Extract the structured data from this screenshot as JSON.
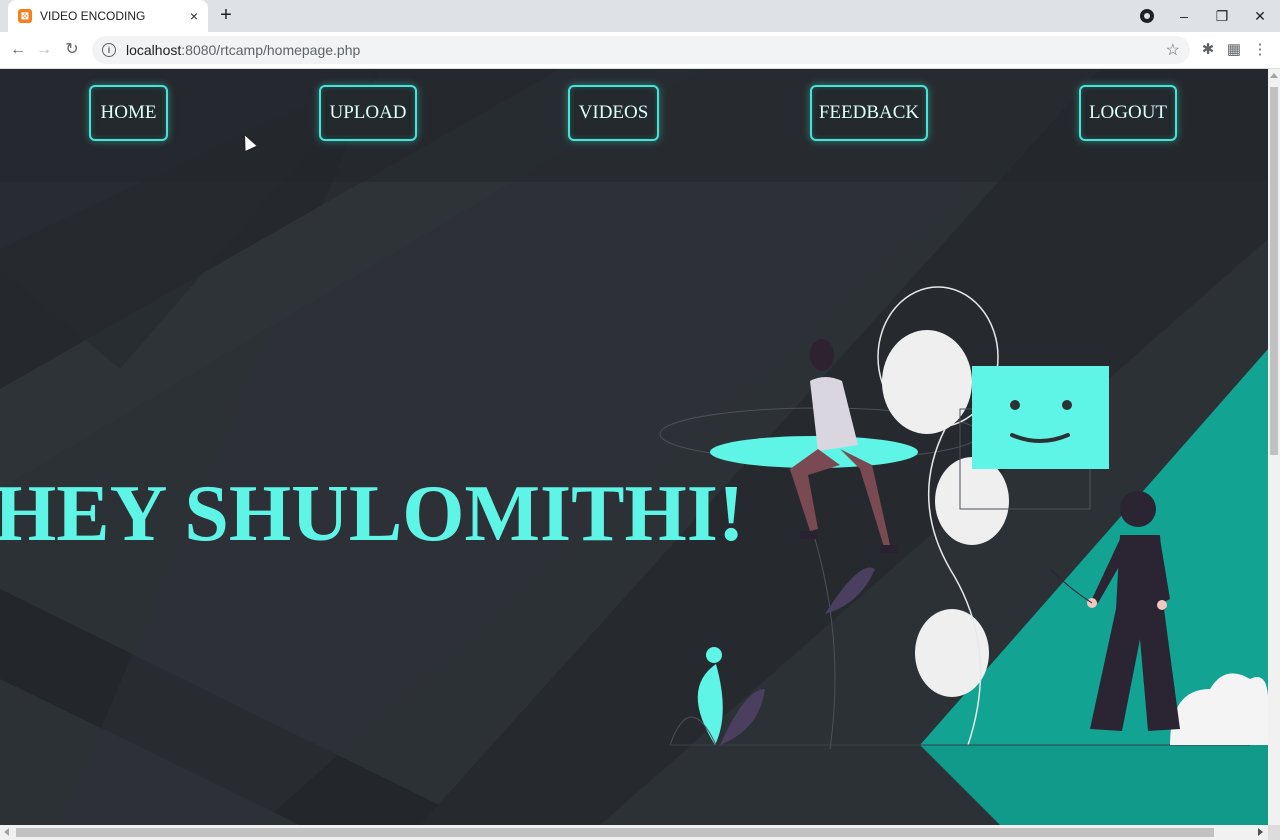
{
  "browser": {
    "tab_title": "VIDEO ENCODING",
    "tab_close": "×",
    "new_tab": "+",
    "url_host": "localhost",
    "url_path": ":8080/rtcamp/homepage.php",
    "window_controls": {
      "minimize": "–",
      "restore": "❐",
      "close": "✕"
    }
  },
  "nav": {
    "items": [
      {
        "label": "HOME"
      },
      {
        "label": "UPLOAD"
      },
      {
        "label": "VIDEOS"
      },
      {
        "label": "FEEDBACK"
      },
      {
        "label": "LOGOUT"
      }
    ]
  },
  "hero": {
    "greeting": "HEY SHULOMITHI!"
  },
  "colors": {
    "accent": "#5ff5e6",
    "nav_border": "#43e6d6",
    "background": "#2c3136",
    "teal_panel": "#0f9a8a"
  },
  "icons": [
    "back-arrow-icon",
    "forward-arrow-icon",
    "reload-icon",
    "info-icon",
    "star-icon",
    "extensions-icon",
    "media-icon",
    "menu-icon",
    "profile-icon"
  ]
}
